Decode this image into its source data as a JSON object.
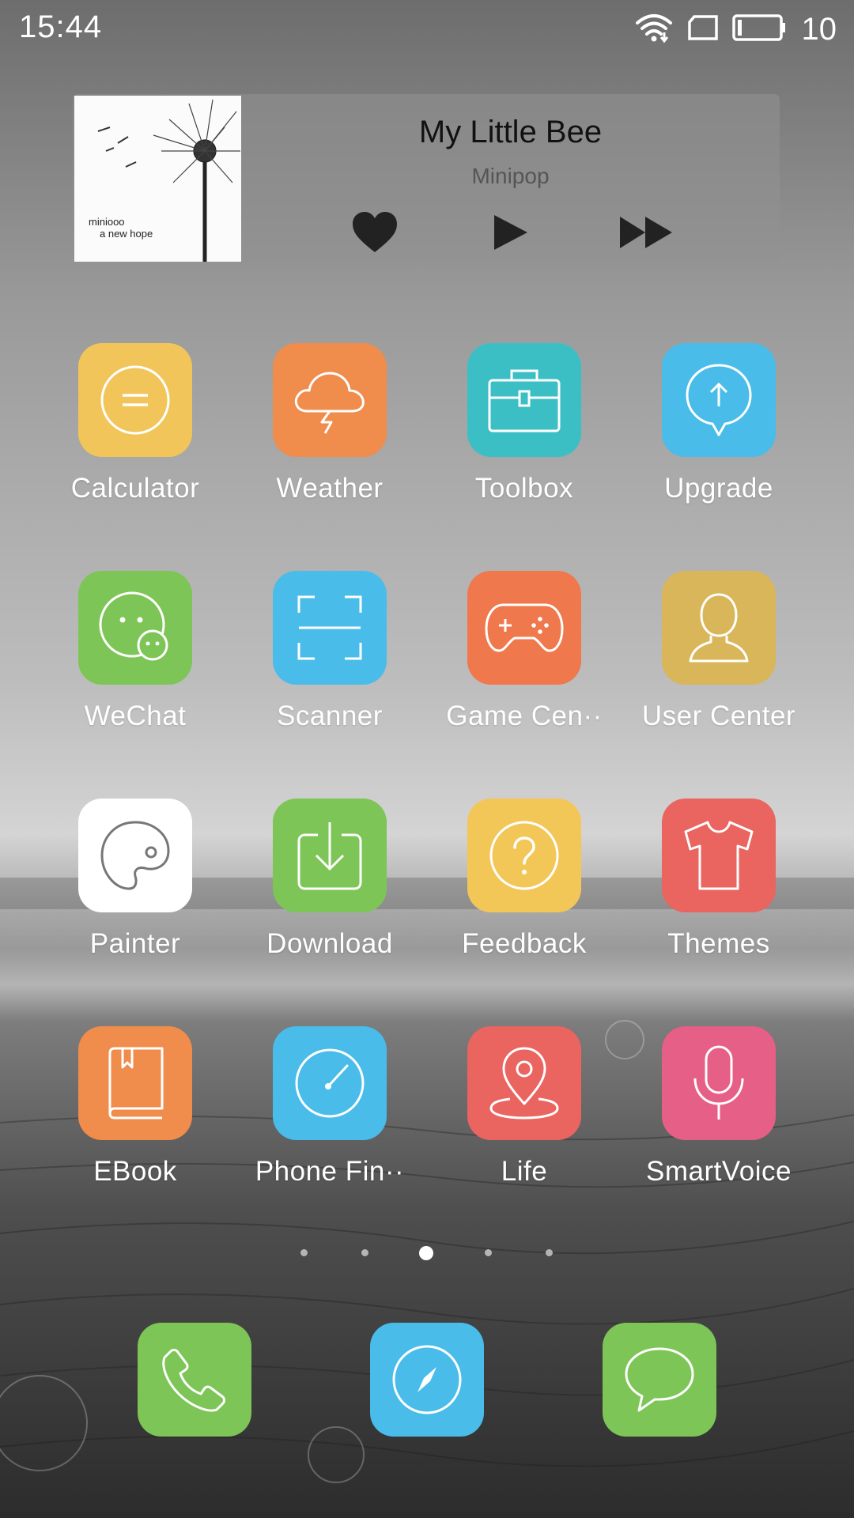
{
  "status_bar": {
    "time": "15:44",
    "battery_level": "10",
    "icons": [
      "wifi-icon",
      "sim-card-icon",
      "battery-icon"
    ]
  },
  "music_widget": {
    "album_text_line1": "miniooo",
    "album_text_line2": "a new hope",
    "title": "My Little Bee",
    "artist": "Minipop",
    "controls": [
      "heart-icon",
      "play-icon",
      "fast-forward-icon"
    ]
  },
  "apps": [
    {
      "label": "Calculator",
      "icon": "calculator-icon",
      "color": "#F1C55A"
    },
    {
      "label": "Weather",
      "icon": "cloud-lightning-icon",
      "color": "#F08C4C"
    },
    {
      "label": "Toolbox",
      "icon": "toolbox-icon",
      "color": "#3CBFC4"
    },
    {
      "label": "Upgrade",
      "icon": "upgrade-icon",
      "color": "#49BCEA"
    },
    {
      "label": "WeChat",
      "icon": "wechat-icon",
      "color": "#7DC557"
    },
    {
      "label": "Scanner",
      "icon": "scanner-icon",
      "color": "#49BCEA"
    },
    {
      "label": "Game Cen··",
      "icon": "gamepad-icon",
      "color": "#EF784C"
    },
    {
      "label": "User Center",
      "icon": "user-icon",
      "color": "#D9B65A"
    },
    {
      "label": "Painter",
      "icon": "palette-icon",
      "color": "#FFFFFF"
    },
    {
      "label": "Download",
      "icon": "download-icon",
      "color": "#7DC557"
    },
    {
      "label": "Feedback",
      "icon": "question-icon",
      "color": "#F3C658"
    },
    {
      "label": "Themes",
      "icon": "tshirt-icon",
      "color": "#EA6460"
    },
    {
      "label": "EBook",
      "icon": "book-icon",
      "color": "#F08C4C"
    },
    {
      "label": "Phone Fin··",
      "icon": "compass-gauge-icon",
      "color": "#49BCEA"
    },
    {
      "label": "Life",
      "icon": "location-pin-icon",
      "color": "#EA6460"
    },
    {
      "label": "SmartVoice",
      "icon": "microphone-icon",
      "color": "#E65F86"
    }
  ],
  "page_indicator": {
    "pages": 5,
    "current": 3
  },
  "dock": [
    {
      "icon": "phone-icon",
      "color": "#7DC557"
    },
    {
      "icon": "browser-compass-icon",
      "color": "#49BCEA"
    },
    {
      "icon": "message-icon",
      "color": "#7DC557"
    }
  ]
}
